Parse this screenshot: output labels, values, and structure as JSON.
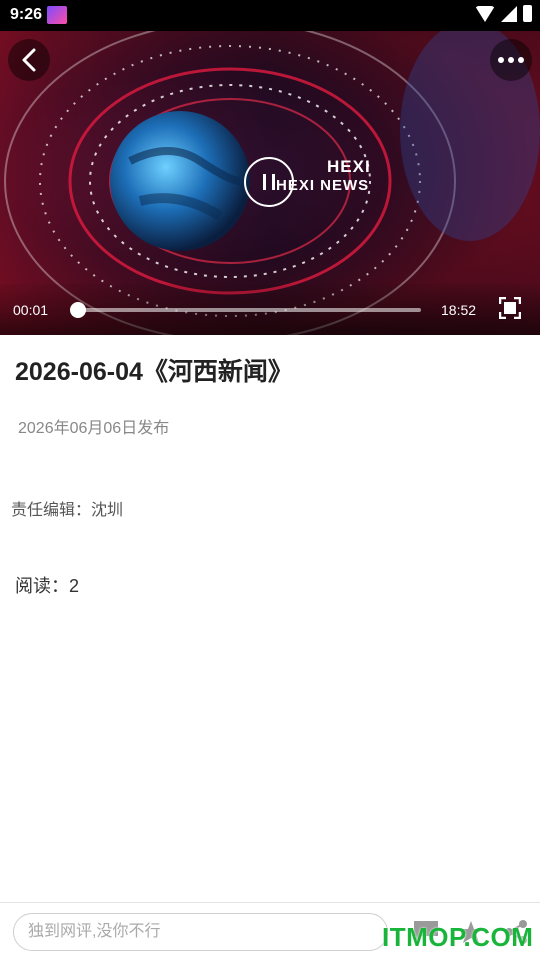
{
  "status_bar": {
    "time": "9:26"
  },
  "player": {
    "brand_line1": "HEXI",
    "brand_line2": "HEXI NEWS",
    "current_time": "00:01",
    "total_time": "18:52",
    "progress": 0.001
  },
  "article": {
    "title": "2026-06-04《河西新闻》",
    "publish_date": "2026年06月06日发布",
    "editor": "责任编辑：沈圳",
    "reads": "阅读：2"
  },
  "comment_bar": {
    "placeholder": "独到网评,没你不行"
  },
  "watermark": "ITMOP.COM",
  "colors": {
    "watermark": "#19b53a",
    "accent_red": "#d0102a"
  }
}
